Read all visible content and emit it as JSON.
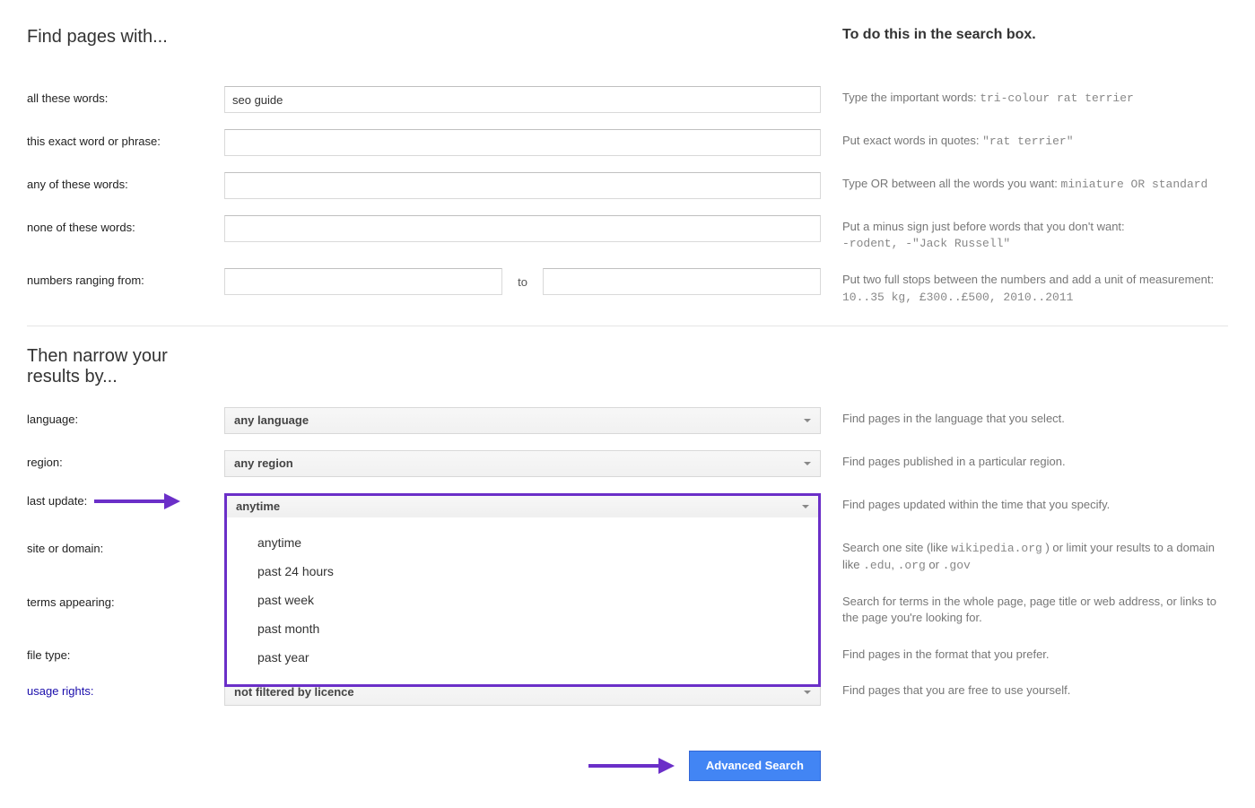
{
  "find": {
    "heading": "Find pages with...",
    "helpHeading": "To do this in the search box.",
    "fields": {
      "all": {
        "label": "all these words:",
        "value": "seo guide",
        "helpPrefix": "Type the important words: ",
        "helpMono": "tri-colour rat terrier"
      },
      "exact": {
        "label": "this exact word or phrase:",
        "value": "",
        "helpPrefix": "Put exact words in quotes: ",
        "helpMono": "\"rat terrier\""
      },
      "any": {
        "label": "any of these words:",
        "value": "",
        "helpPrefix": "Type ",
        "helpSc": "OR",
        "helpMid": " between all the words you want: ",
        "helpMono": "miniature OR standard"
      },
      "none": {
        "label": "none of these words:",
        "value": "",
        "helpLine1": "Put a minus sign just before words that you don't want:",
        "helpMono": "-rodent, -\"Jack Russell\""
      },
      "range": {
        "label": "numbers ranging from:",
        "from": "",
        "to": "",
        "toText": "to",
        "helpLine1": "Put two full stops between the numbers and add a unit of measurement:",
        "helpMono": "10..35 kg, £300..£500, 2010..2011"
      }
    }
  },
  "narrow": {
    "heading": "Then narrow your results by...",
    "language": {
      "label": "language:",
      "selected": "any language",
      "help": "Find pages in the language that you select."
    },
    "region": {
      "label": "region:",
      "selected": "any region",
      "help": "Find pages published in a particular region."
    },
    "lastUpdate": {
      "label": "last update:",
      "selected": "anytime",
      "options": [
        "anytime",
        "past 24 hours",
        "past week",
        "past month",
        "past year"
      ],
      "help": "Find pages updated within the time that you specify."
    },
    "site": {
      "label": "site or domain:",
      "helpA": "Search one site (like ",
      "helpMono1": "wikipedia.org",
      "helpB": " ) or limit your results to a domain like ",
      "helpMono2": ".edu",
      "helpC": ", ",
      "helpMono3": ".org",
      "helpD": " or ",
      "helpMono4": ".gov"
    },
    "terms": {
      "label": "terms appearing:",
      "help": "Search for terms in the whole page, page title or web address, or links to the page you're looking for."
    },
    "fileType": {
      "label": "file type:",
      "help": "Find pages in the format that you prefer."
    },
    "usage": {
      "label": "usage rights:",
      "selected": "not filtered by licence",
      "help": "Find pages that you are free to use yourself."
    }
  },
  "button": "Advanced Search"
}
